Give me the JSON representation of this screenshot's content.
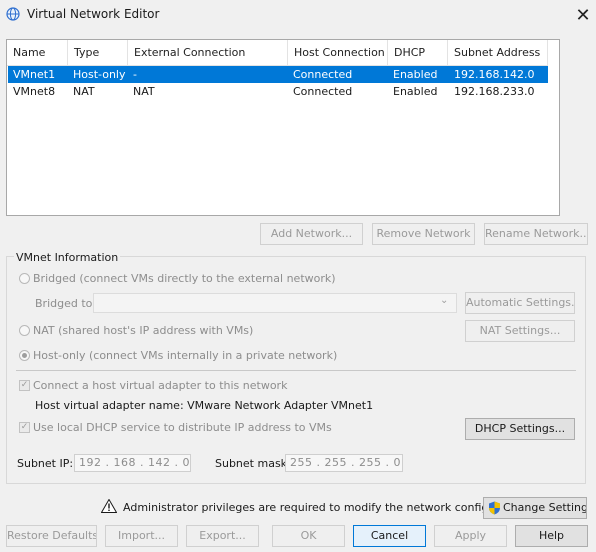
{
  "window": {
    "title": "Virtual Network Editor",
    "close_glyph": "✕"
  },
  "table": {
    "columns": [
      "Name",
      "Type",
      "External Connection",
      "Host Connection",
      "DHCP",
      "Subnet Address"
    ],
    "rows": [
      {
        "name": "VMnet1",
        "type": "Host-only",
        "external": "-",
        "host": "Connected",
        "dhcp": "Enabled",
        "subnet": "192.168.142.0",
        "selected": true
      },
      {
        "name": "VMnet8",
        "type": "NAT",
        "external": "NAT",
        "host": "Connected",
        "dhcp": "Enabled",
        "subnet": "192.168.233.0",
        "selected": false
      }
    ]
  },
  "net_buttons": {
    "add": "Add Network...",
    "remove": "Remove Network",
    "rename": "Rename Network..."
  },
  "vmnet_info": {
    "title": "VMnet Information",
    "bridged_label": "Bridged (connect VMs directly to the external network)",
    "bridged_to_label": "Bridged to:",
    "auto_settings": "Automatic Settings...",
    "nat_label": "NAT (shared host's IP address with VMs)",
    "nat_settings": "NAT Settings...",
    "hostonly_label": "Host-only (connect VMs internally in a private network)",
    "connect_adapter_label": "Connect a host virtual adapter to this network",
    "adapter_name_label": "Host virtual adapter name: VMware Network Adapter VMnet1",
    "dhcp_label": "Use local DHCP service to distribute IP address to VMs",
    "dhcp_settings": "DHCP Settings...",
    "subnet_ip_label": "Subnet IP:",
    "subnet_ip": "192 . 168 . 142 .  0",
    "subnet_mask_label": "Subnet mask:",
    "subnet_mask": "255 . 255 . 255 .  0",
    "mode": "host-only",
    "connect_adapter_checked": true,
    "dhcp_checked": true
  },
  "admin": {
    "warning": "Administrator privileges are required to modify the network configuration.",
    "change_settings": "Change Settings"
  },
  "footer": {
    "restore": "Restore Defaults",
    "import": "Import...",
    "export": "Export...",
    "ok": "OK",
    "cancel": "Cancel",
    "apply": "Apply",
    "help": "Help"
  },
  "colors": {
    "selection": "#0078d7",
    "window_bg": "#f0f0f0",
    "warning": "#f2c200",
    "shield_blue": "#2f6fcf"
  },
  "icons": {
    "app": "network-globe-icon",
    "close": "close-icon",
    "warning": "warning-icon",
    "shield": "uac-shield-icon",
    "dropdown": "chevron-down-icon"
  }
}
